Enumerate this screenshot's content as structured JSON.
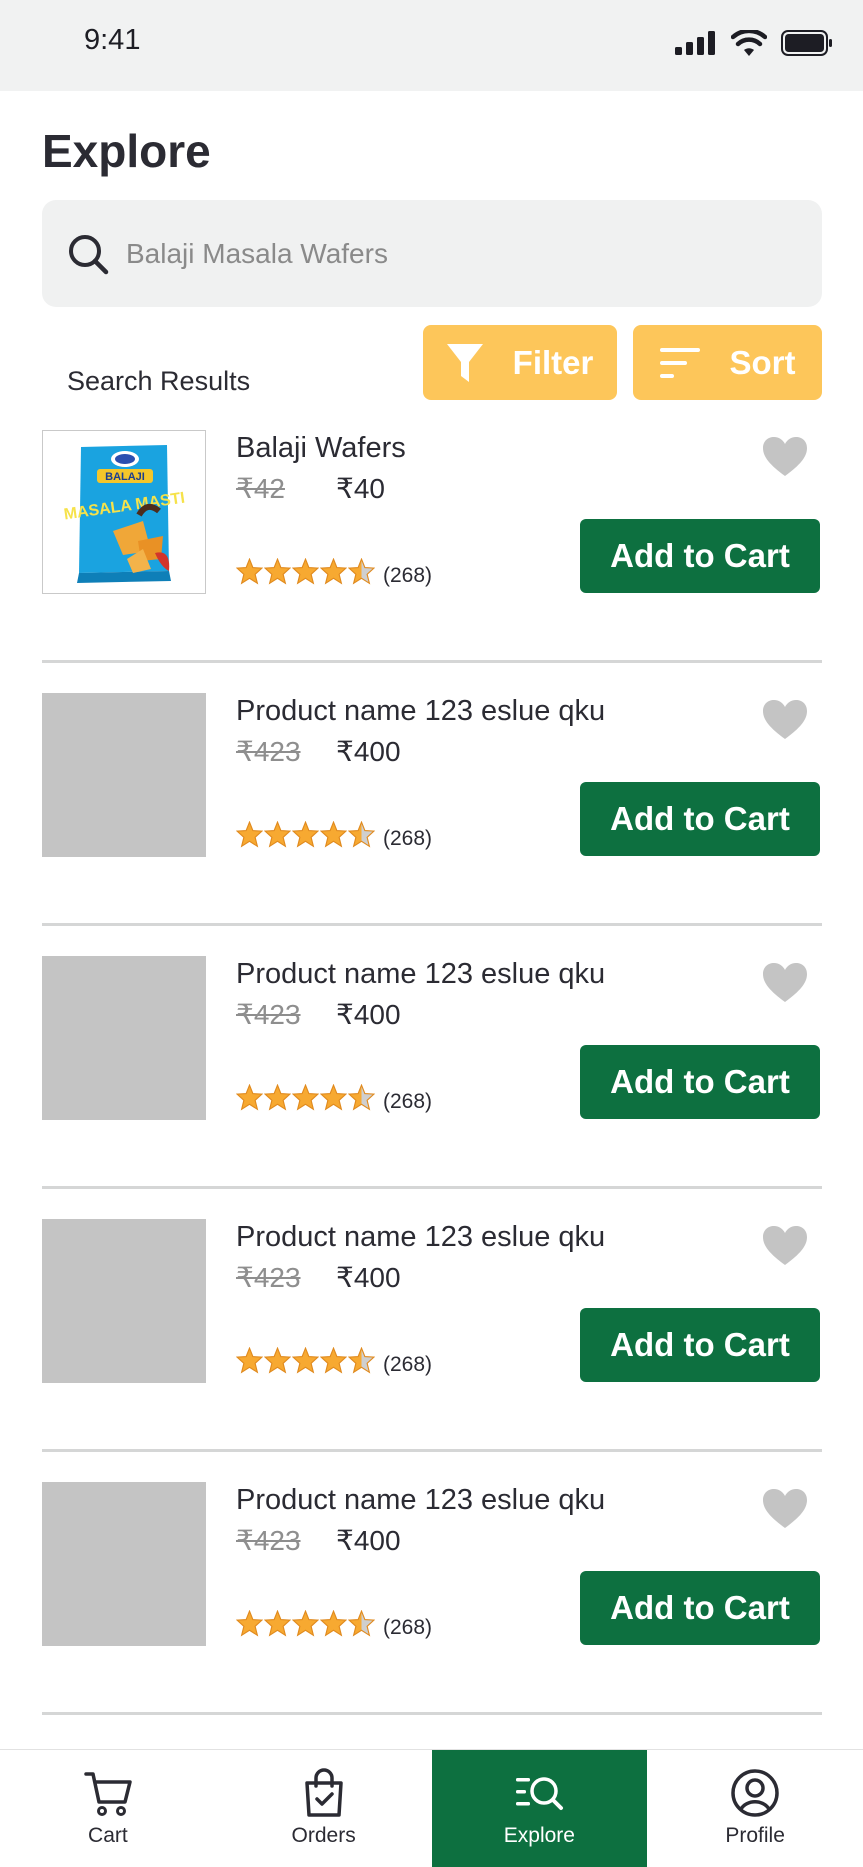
{
  "status_bar": {
    "time": "9:41"
  },
  "page": {
    "title": "Explore"
  },
  "search": {
    "placeholder": "Balaji Masala Wafers"
  },
  "results_label": "Search Results",
  "filter_label": "Filter",
  "sort_label": "Sort",
  "colors": {
    "accent_green": "#0d7040",
    "accent_yellow": "#fdc65a",
    "star": "#f7a931"
  },
  "products": [
    {
      "name": "Balaji Wafers",
      "old_price": "₹42",
      "price": "₹40",
      "rating": 4.5,
      "rating_count": "(268)",
      "cta": "Add to Cart",
      "has_image": true,
      "image_brand": "BALAJI",
      "image_title": "MASALA MASTI"
    },
    {
      "name": "Product name 123 eslue qku",
      "old_price": "₹423",
      "price": "₹400",
      "rating": 4.5,
      "rating_count": "(268)",
      "cta": "Add to Cart",
      "has_image": false
    },
    {
      "name": "Product name 123 eslue qku",
      "old_price": "₹423",
      "price": "₹400",
      "rating": 4.5,
      "rating_count": "(268)",
      "cta": "Add to Cart",
      "has_image": false
    },
    {
      "name": "Product name 123 eslue qku",
      "old_price": "₹423",
      "price": "₹400",
      "rating": 4.5,
      "rating_count": "(268)",
      "cta": "Add to Cart",
      "has_image": false
    },
    {
      "name": "Product name 123 eslue qku",
      "old_price": "₹423",
      "price": "₹400",
      "rating": 4.5,
      "rating_count": "(268)",
      "cta": "Add to Cart",
      "has_image": false
    }
  ],
  "tabs": [
    {
      "label": "Cart",
      "icon": "cart-icon",
      "active": false
    },
    {
      "label": "Orders",
      "icon": "orders-bag-icon",
      "active": false
    },
    {
      "label": "Explore",
      "icon": "explore-search-icon",
      "active": true
    },
    {
      "label": "Profile",
      "icon": "profile-icon",
      "active": false
    }
  ]
}
